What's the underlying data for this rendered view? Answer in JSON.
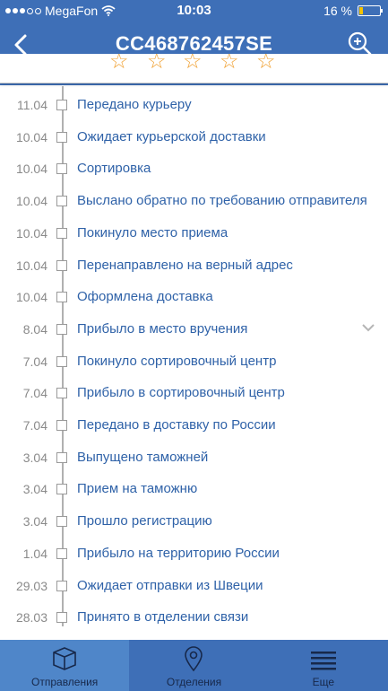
{
  "status_bar": {
    "carrier": "MegaFon",
    "time": "10:03",
    "battery": "16 %",
    "battery_fraction": 0.16
  },
  "nav": {
    "title": "CC468762457SE",
    "back_icon": "chevron-left-icon",
    "zoom_icon": "zoom-in-icon"
  },
  "rating": {
    "stars": 5,
    "accent": "#f0a235"
  },
  "events": [
    {
      "date": "11.04",
      "label": "Передано курьеру"
    },
    {
      "date": "10.04",
      "label": "Ожидает курьерской доставки"
    },
    {
      "date": "10.04",
      "label": "Сортировка"
    },
    {
      "date": "10.04",
      "label": "Выслано обратно по требованию отправителя"
    },
    {
      "date": "10.04",
      "label": "Покинуло место приема"
    },
    {
      "date": "10.04",
      "label": "Перенаправлено на верный адрес"
    },
    {
      "date": "10.04",
      "label": "Оформлена доставка"
    },
    {
      "date": "8.04",
      "label": "Прибыло в место вручения"
    },
    {
      "date": "7.04",
      "label": "Покинуло сортировочный центр"
    },
    {
      "date": "7.04",
      "label": "Прибыло в сортировочный центр"
    },
    {
      "date": "7.04",
      "label": "Передано в доставку по России"
    },
    {
      "date": "3.04",
      "label": "Выпущено таможней"
    },
    {
      "date": "3.04",
      "label": "Прием на таможню"
    },
    {
      "date": "3.04",
      "label": "Прошло регистрацию"
    },
    {
      "date": "1.04",
      "label": "Прибыло на территорию России"
    },
    {
      "date": "29.03",
      "label": "Ожидает отправки из Швеции"
    },
    {
      "date": "28.03",
      "label": "Принято в отделении связи"
    }
  ],
  "tabs": [
    {
      "label": "Отправления",
      "icon": "package-icon",
      "active": true
    },
    {
      "label": "Отделения",
      "icon": "location-pin-icon",
      "active": false
    },
    {
      "label": "Еще",
      "icon": "menu-icon",
      "active": false
    }
  ],
  "colors": {
    "primary": "#3e6fb7",
    "link": "#2f62a8",
    "active_tab": "#4f86c9"
  }
}
